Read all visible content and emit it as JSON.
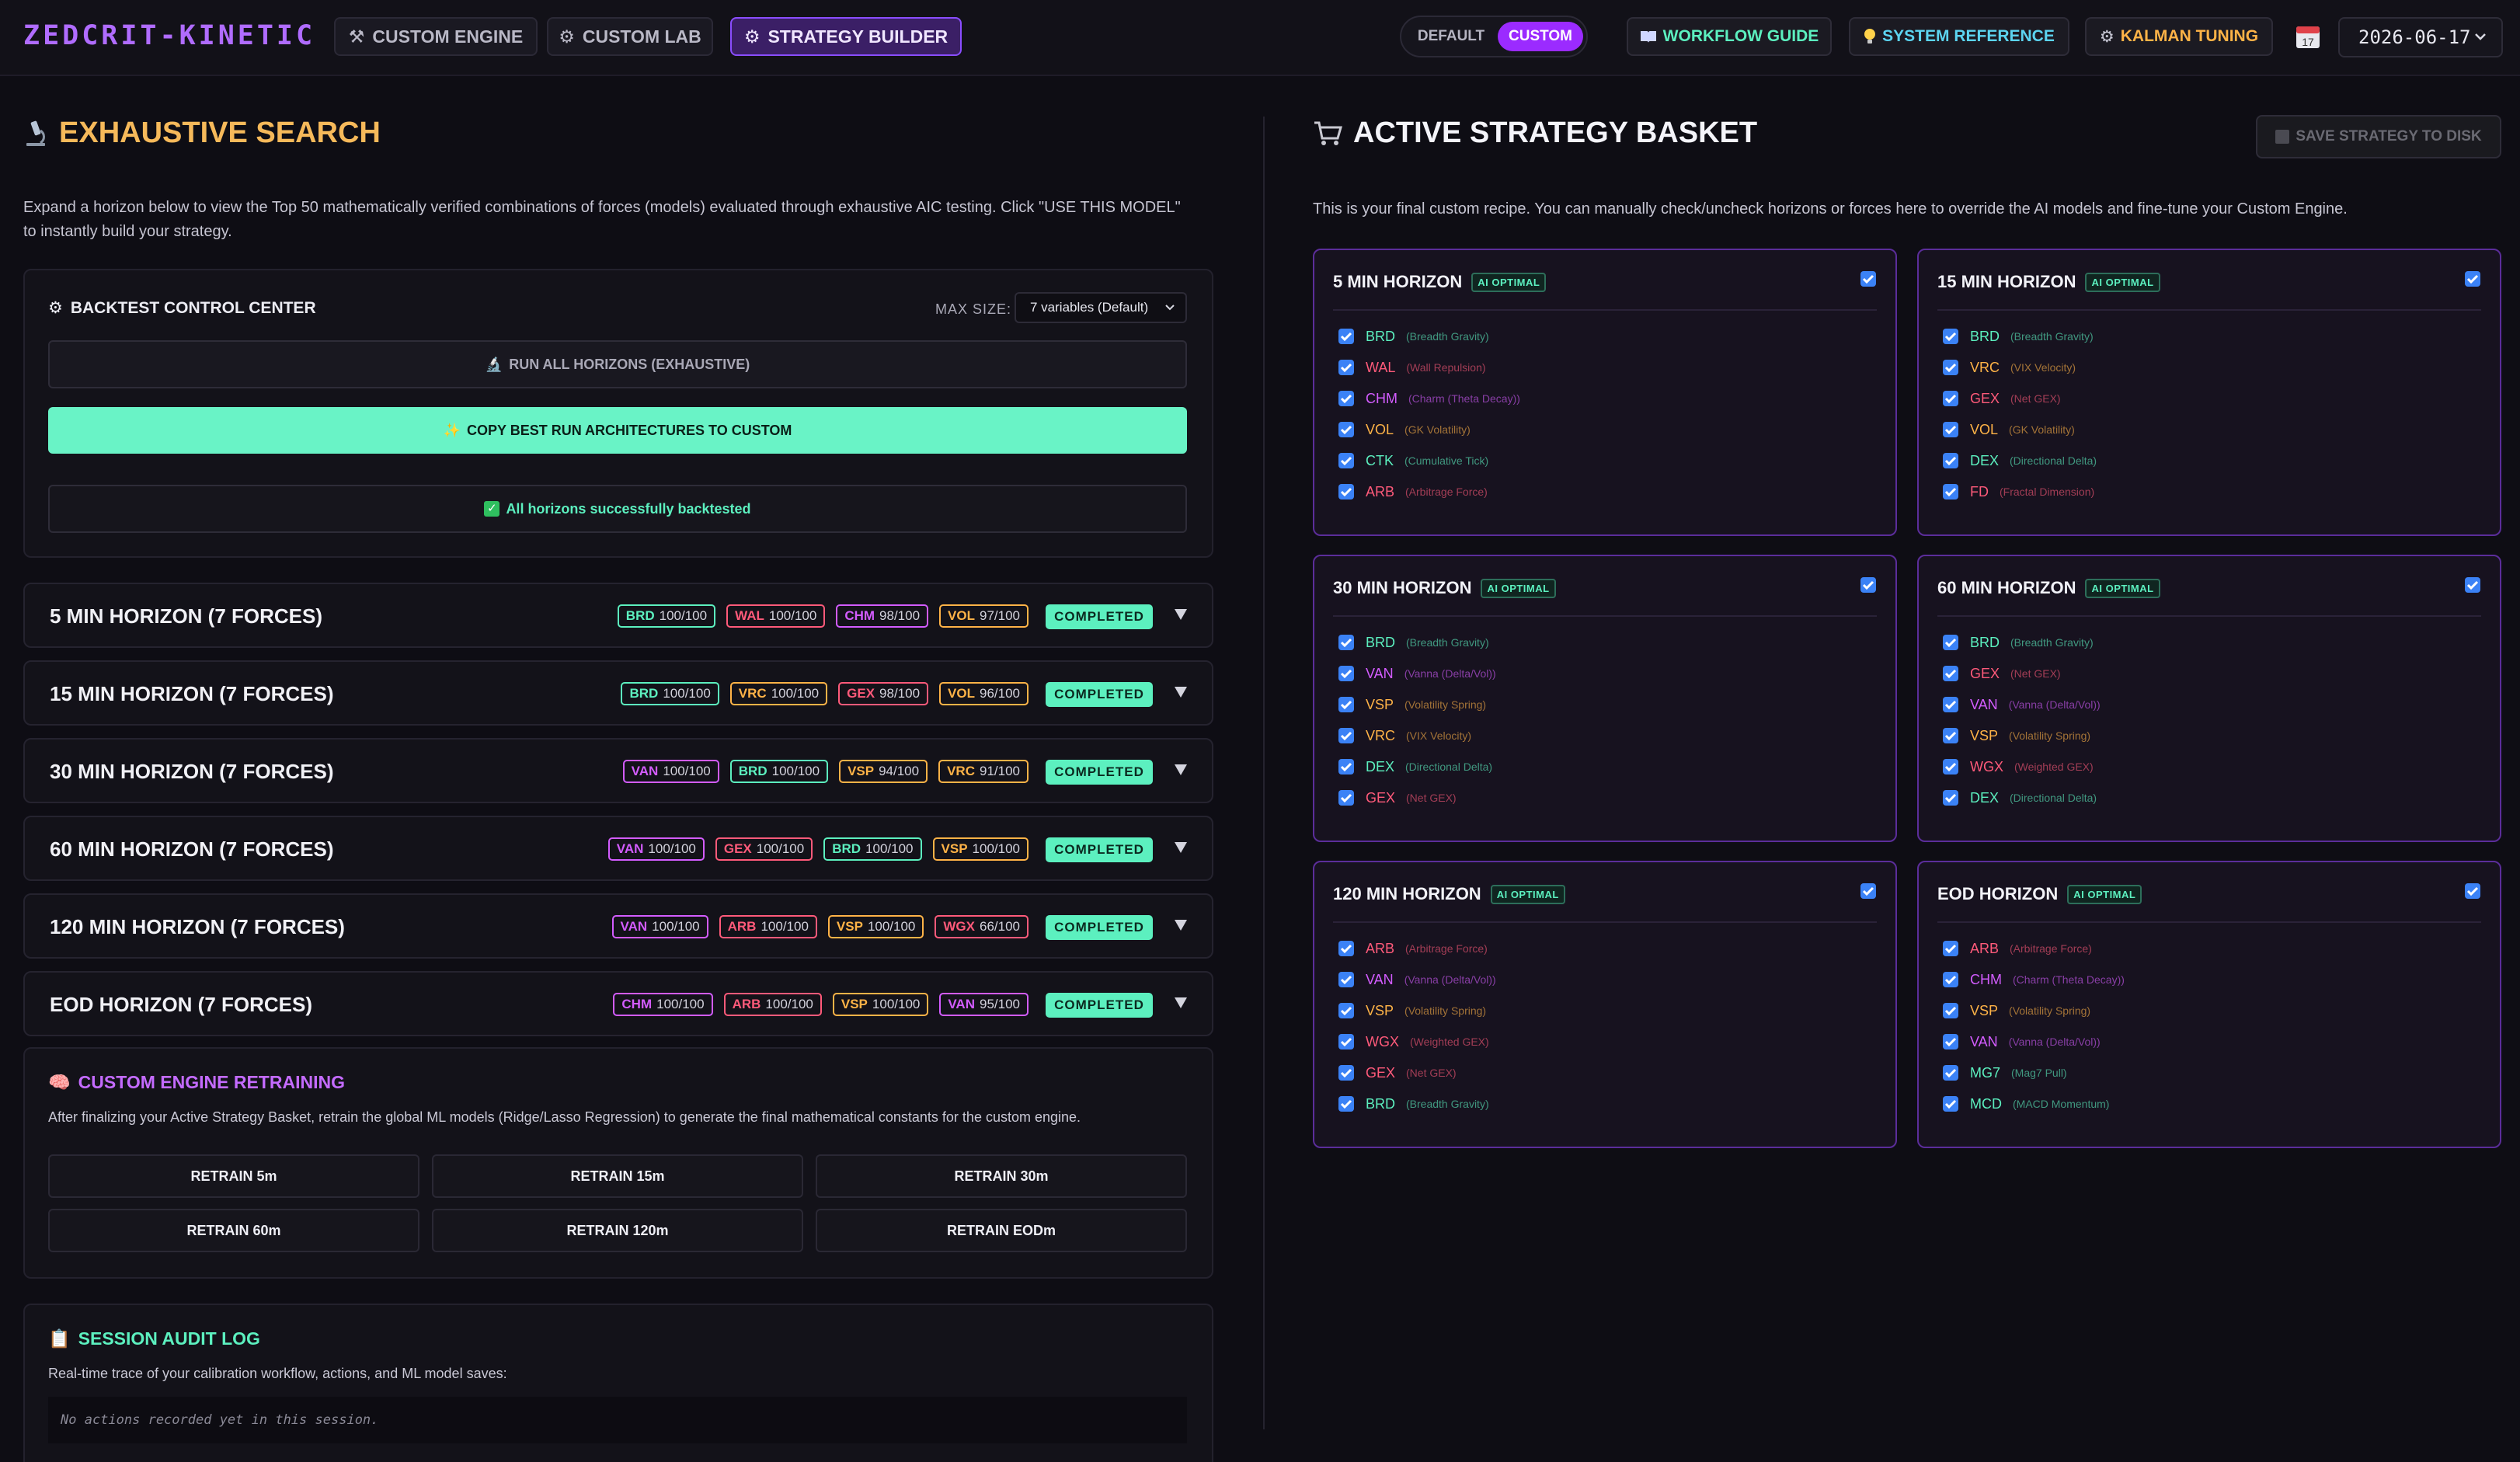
{
  "app": {
    "brand": "ZEDCRIT-KINETIC",
    "nav": [
      {
        "label": "CUSTOM ENGINE",
        "icon": "⚒"
      },
      {
        "label": "CUSTOM LAB",
        "icon": "⚙"
      },
      {
        "label": "STRATEGY BUILDER",
        "icon": "⚙"
      }
    ],
    "mode_toggle": {
      "default": "DEFAULT",
      "custom": "CUSTOM"
    },
    "workflow_guide": "WORKFLOW GUIDE",
    "system_reference": "SYSTEM REFERENCE",
    "kalman_tuning": "KALMAN TUNING",
    "date": "2026-06-17",
    "calendar_day": "17"
  },
  "search": {
    "title": "EXHAUSTIVE SEARCH",
    "intro": "Expand a horizon below to view the Top 50 mathematically verified combinations of forces (models) evaluated through exhaustive AIC testing. Click \"USE THIS MODEL\" to instantly build your strategy.",
    "control": {
      "title": "BACKTEST CONTROL CENTER",
      "max_size_label": "MAX SIZE:",
      "max_size_value": "7 variables (Default)",
      "run_all": "RUN ALL HORIZONS (EXHAUSTIVE)",
      "copy_best": "COPY BEST RUN ARCHITECTURES TO CUSTOM",
      "status": "All horizons successfully backtested"
    },
    "horizons": [
      {
        "title": "5 MIN HORIZON (7 FORCES)",
        "status": "COMPLETED",
        "badges": [
          {
            "code": "BRD",
            "score": "100/100",
            "color": "#5cf0bf"
          },
          {
            "code": "WAL",
            "score": "100/100",
            "color": "#ff5a7a"
          },
          {
            "code": "CHM",
            "score": "98/100",
            "color": "#d35cff"
          },
          {
            "code": "VOL",
            "score": "97/100",
            "color": "#ffb347"
          }
        ]
      },
      {
        "title": "15 MIN HORIZON (7 FORCES)",
        "status": "COMPLETED",
        "badges": [
          {
            "code": "BRD",
            "score": "100/100",
            "color": "#5cf0bf"
          },
          {
            "code": "VRC",
            "score": "100/100",
            "color": "#ffb347"
          },
          {
            "code": "GEX",
            "score": "98/100",
            "color": "#ff5a7a"
          },
          {
            "code": "VOL",
            "score": "96/100",
            "color": "#ffb347"
          }
        ]
      },
      {
        "title": "30 MIN HORIZON (7 FORCES)",
        "status": "COMPLETED",
        "badges": [
          {
            "code": "VAN",
            "score": "100/100",
            "color": "#d35cff"
          },
          {
            "code": "BRD",
            "score": "100/100",
            "color": "#5cf0bf"
          },
          {
            "code": "VSP",
            "score": "94/100",
            "color": "#ffb347"
          },
          {
            "code": "VRC",
            "score": "91/100",
            "color": "#ffb347"
          }
        ]
      },
      {
        "title": "60 MIN HORIZON (7 FORCES)",
        "status": "COMPLETED",
        "badges": [
          {
            "code": "VAN",
            "score": "100/100",
            "color": "#d35cff"
          },
          {
            "code": "GEX",
            "score": "100/100",
            "color": "#ff5a7a"
          },
          {
            "code": "BRD",
            "score": "100/100",
            "color": "#5cf0bf"
          },
          {
            "code": "VSP",
            "score": "100/100",
            "color": "#ffb347"
          }
        ]
      },
      {
        "title": "120 MIN HORIZON (7 FORCES)",
        "status": "COMPLETED",
        "badges": [
          {
            "code": "VAN",
            "score": "100/100",
            "color": "#d35cff"
          },
          {
            "code": "ARB",
            "score": "100/100",
            "color": "#ff5a7a"
          },
          {
            "code": "VSP",
            "score": "100/100",
            "color": "#ffb347"
          },
          {
            "code": "WGX",
            "score": "66/100",
            "color": "#ff5a7a"
          }
        ]
      },
      {
        "title": "EOD HORIZON (7 FORCES)",
        "status": "COMPLETED",
        "badges": [
          {
            "code": "CHM",
            "score": "100/100",
            "color": "#d35cff"
          },
          {
            "code": "ARB",
            "score": "100/100",
            "color": "#ff5a7a"
          },
          {
            "code": "VSP",
            "score": "100/100",
            "color": "#ffb347"
          },
          {
            "code": "VAN",
            "score": "95/100",
            "color": "#d35cff"
          }
        ]
      }
    ],
    "retrain": {
      "title": "CUSTOM ENGINE RETRAINING",
      "desc": "After finalizing your Active Strategy Basket, retrain the global ML models (Ridge/Lasso Regression) to generate the final mathematical constants for the custom engine.",
      "buttons": [
        "RETRAIN 5m",
        "RETRAIN 15m",
        "RETRAIN 30m",
        "RETRAIN 60m",
        "RETRAIN 120m",
        "RETRAIN EODm"
      ]
    },
    "audit": {
      "title": "SESSION AUDIT LOG",
      "desc": "Real-time trace of your calibration workflow, actions, and ML model saves:",
      "empty": "No actions recorded yet in this session."
    }
  },
  "basket": {
    "title": "ACTIVE STRATEGY BASKET",
    "save": "SAVE STRATEGY TO DISK",
    "desc": "This is your final custom recipe. You can manually check/uncheck horizons or forces here to override the AI models and fine-tune your Custom Engine.",
    "ai_tag": "AI OPTIMAL",
    "cards": [
      {
        "title": "5 MIN HORIZON",
        "forces": [
          {
            "code": "BRD",
            "desc": "(Breadth Gravity)",
            "color": "#5cf0bf"
          },
          {
            "code": "WAL",
            "desc": "(Wall Repulsion)",
            "color": "#ff5a7a"
          },
          {
            "code": "CHM",
            "desc": "(Charm (Theta Decay))",
            "color": "#d35cff"
          },
          {
            "code": "VOL",
            "desc": "(GK Volatility)",
            "color": "#ffb347"
          },
          {
            "code": "CTK",
            "desc": "(Cumulative Tick)",
            "color": "#5cf0bf"
          },
          {
            "code": "ARB",
            "desc": "(Arbitrage Force)",
            "color": "#ff5a7a"
          }
        ]
      },
      {
        "title": "15 MIN HORIZON",
        "forces": [
          {
            "code": "BRD",
            "desc": "(Breadth Gravity)",
            "color": "#5cf0bf"
          },
          {
            "code": "VRC",
            "desc": "(VIX Velocity)",
            "color": "#ffb347"
          },
          {
            "code": "GEX",
            "desc": "(Net GEX)",
            "color": "#ff5a7a"
          },
          {
            "code": "VOL",
            "desc": "(GK Volatility)",
            "color": "#ffb347"
          },
          {
            "code": "DEX",
            "desc": "(Directional Delta)",
            "color": "#5cf0bf"
          },
          {
            "code": "FD",
            "desc": "(Fractal Dimension)",
            "color": "#ff5a7a"
          }
        ]
      },
      {
        "title": "30 MIN HORIZON",
        "forces": [
          {
            "code": "BRD",
            "desc": "(Breadth Gravity)",
            "color": "#5cf0bf"
          },
          {
            "code": "VAN",
            "desc": "(Vanna (Delta/Vol))",
            "color": "#d35cff"
          },
          {
            "code": "VSP",
            "desc": "(Volatility Spring)",
            "color": "#ffb347"
          },
          {
            "code": "VRC",
            "desc": "(VIX Velocity)",
            "color": "#ffb347"
          },
          {
            "code": "DEX",
            "desc": "(Directional Delta)",
            "color": "#5cf0bf"
          },
          {
            "code": "GEX",
            "desc": "(Net GEX)",
            "color": "#ff5a7a"
          }
        ]
      },
      {
        "title": "60 MIN HORIZON",
        "forces": [
          {
            "code": "BRD",
            "desc": "(Breadth Gravity)",
            "color": "#5cf0bf"
          },
          {
            "code": "GEX",
            "desc": "(Net GEX)",
            "color": "#ff5a7a"
          },
          {
            "code": "VAN",
            "desc": "(Vanna (Delta/Vol))",
            "color": "#d35cff"
          },
          {
            "code": "VSP",
            "desc": "(Volatility Spring)",
            "color": "#ffb347"
          },
          {
            "code": "WGX",
            "desc": "(Weighted GEX)",
            "color": "#ff5a7a"
          },
          {
            "code": "DEX",
            "desc": "(Directional Delta)",
            "color": "#5cf0bf"
          }
        ]
      },
      {
        "title": "120 MIN HORIZON",
        "forces": [
          {
            "code": "ARB",
            "desc": "(Arbitrage Force)",
            "color": "#ff5a7a"
          },
          {
            "code": "VAN",
            "desc": "(Vanna (Delta/Vol))",
            "color": "#d35cff"
          },
          {
            "code": "VSP",
            "desc": "(Volatility Spring)",
            "color": "#ffb347"
          },
          {
            "code": "WGX",
            "desc": "(Weighted GEX)",
            "color": "#ff5a7a"
          },
          {
            "code": "GEX",
            "desc": "(Net GEX)",
            "color": "#ff5a7a"
          },
          {
            "code": "BRD",
            "desc": "(Breadth Gravity)",
            "color": "#5cf0bf"
          }
        ]
      },
      {
        "title": "EOD HORIZON",
        "forces": [
          {
            "code": "ARB",
            "desc": "(Arbitrage Force)",
            "color": "#ff5a7a"
          },
          {
            "code": "CHM",
            "desc": "(Charm (Theta Decay))",
            "color": "#d35cff"
          },
          {
            "code": "VSP",
            "desc": "(Volatility Spring)",
            "color": "#ffb347"
          },
          {
            "code": "VAN",
            "desc": "(Vanna (Delta/Vol))",
            "color": "#d35cff"
          },
          {
            "code": "MG7",
            "desc": "(Mag7 Pull)",
            "color": "#5cf0bf"
          },
          {
            "code": "MCD",
            "desc": "(MACD Momentum)",
            "color": "#5cf0bf"
          }
        ]
      }
    ]
  }
}
